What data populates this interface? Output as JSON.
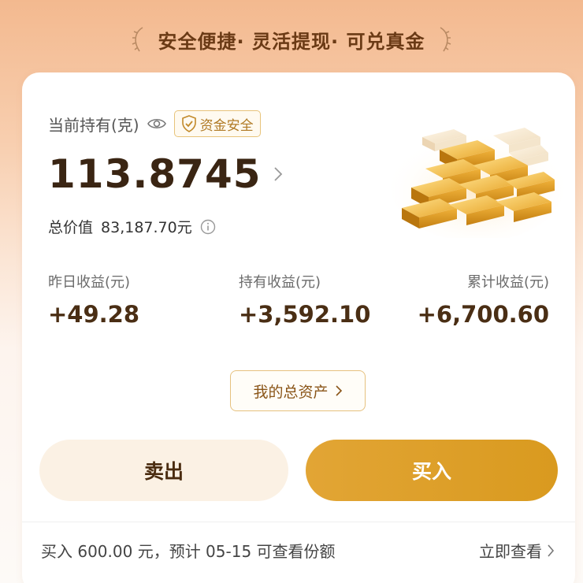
{
  "banner": {
    "text": "安全便捷· 灵活提现· 可兑真金"
  },
  "holding": {
    "label": "当前持有(克)",
    "badge": "资金安全",
    "grams": "113.8745",
    "total_label": "总价值",
    "total_value": "83,187.70元"
  },
  "stats": [
    {
      "label": "昨日收益(元)",
      "value": "+49.28"
    },
    {
      "label": "持有收益(元)",
      "value": "+3,592.10"
    },
    {
      "label": "累计收益(元)",
      "value": "+6,700.60"
    }
  ],
  "actions": {
    "assets_label": "我的总资产",
    "sell_label": "卖出",
    "buy_label": "买入"
  },
  "notice": {
    "text": "买入 600.00 元，预计 05-15 可查看份额",
    "link": "立即查看"
  },
  "colors": {
    "accent": "#dc9f26",
    "badge_border": "#e7c37a",
    "value_text": "#4a2e14"
  },
  "icons": [
    "laurel-left-icon",
    "laurel-right-icon",
    "eye-icon",
    "shield-icon",
    "chevron-right-icon",
    "info-icon",
    "gold-bars-image"
  ]
}
